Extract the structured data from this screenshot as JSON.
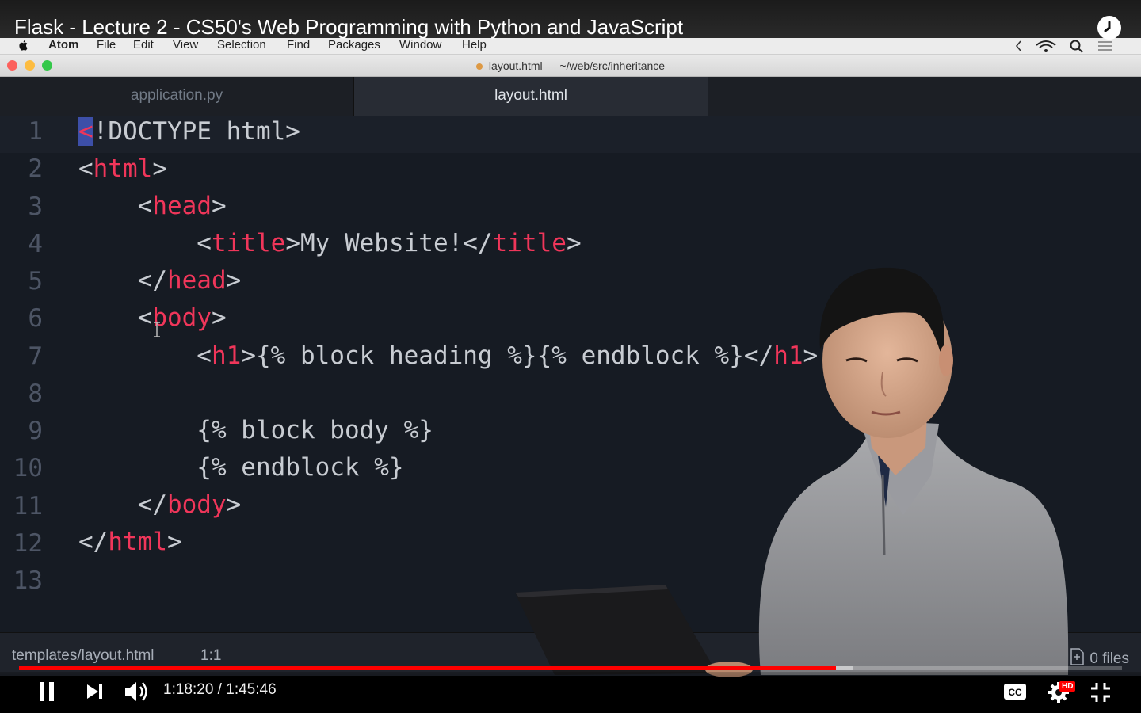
{
  "video": {
    "title": "Flask - Lecture 2 - CS50's Web Programming with Python and JavaScript",
    "current_time": "1:18:20",
    "duration": "1:45:46",
    "time_separator": " / ",
    "progress": 0.7407,
    "buffered": 0.7557,
    "quality_badge": "HD",
    "accent_color": "#ff0000"
  },
  "menubar": {
    "items": [
      "Atom",
      "File",
      "Edit",
      "View",
      "Selection",
      "Find",
      "Packages",
      "Window",
      "Help"
    ]
  },
  "window": {
    "title": "layout.html — ~/web/src/inheritance"
  },
  "tabs": [
    {
      "label": "application.py",
      "active": false
    },
    {
      "label": "layout.html",
      "active": true
    }
  ],
  "editor": {
    "line_numbers": [
      "1",
      "2",
      "3",
      "4",
      "5",
      "6",
      "7",
      "8",
      "9",
      "10",
      "11",
      "12",
      "13"
    ],
    "colors": {
      "tag": "#f0365a",
      "text": "#c8ccd2",
      "background": "#161b23",
      "gutter": "#4d5565"
    }
  },
  "status": {
    "path": "templates/layout.html",
    "cursor": "1:1",
    "files": "0 files"
  }
}
